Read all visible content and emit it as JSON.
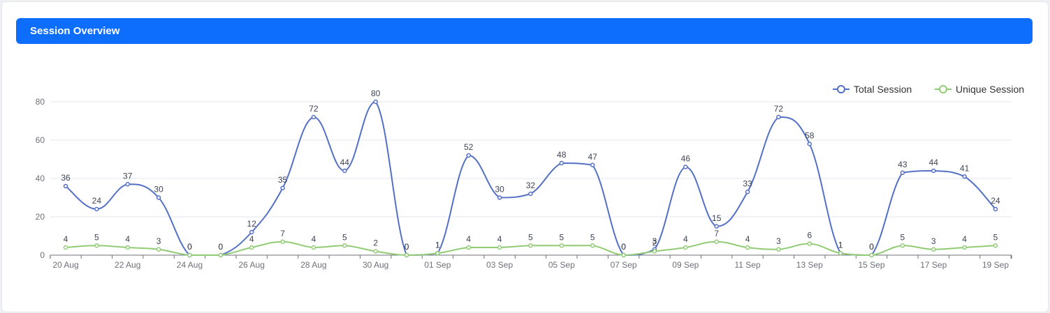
{
  "panel": {
    "title": "Session Overview"
  },
  "colors": {
    "accent": "#0d6efd",
    "total": "#5470c6",
    "unique": "#91cc75"
  },
  "chart_data": {
    "type": "line",
    "smooth": true,
    "categories": [
      "20 Aug",
      "21 Aug",
      "22 Aug",
      "23 Aug",
      "24 Aug",
      "25 Aug",
      "26 Aug",
      "27 Aug",
      "28 Aug",
      "29 Aug",
      "30 Aug",
      "31 Aug",
      "01 Sep",
      "02 Sep",
      "03 Sep",
      "04 Sep",
      "05 Sep",
      "06 Sep",
      "07 Sep",
      "08 Sep",
      "09 Sep",
      "10 Sep",
      "11 Sep",
      "12 Sep",
      "13 Sep",
      "14 Sep",
      "15 Sep",
      "16 Sep",
      "17 Sep",
      "18 Sep",
      "19 Sep"
    ],
    "tick_labels": [
      "20 Aug",
      "22 Aug",
      "24 Aug",
      "26 Aug",
      "28 Aug",
      "30 Aug",
      "01 Sep",
      "03 Sep",
      "05 Sep",
      "07 Sep",
      "09 Sep",
      "11 Sep",
      "13 Sep",
      "15 Sep",
      "17 Sep",
      "19 Sep"
    ],
    "yticks": [
      "0",
      "20",
      "40",
      "60",
      "80"
    ],
    "ylim": [
      0,
      80
    ],
    "grid": true,
    "legend_position": "top-right",
    "series": [
      {
        "name": "Total Session",
        "values": [
          36,
          24,
          37,
          30,
          0,
          0,
          12,
          35,
          72,
          44,
          80,
          0,
          1,
          52,
          30,
          32,
          48,
          47,
          0,
          3,
          46,
          15,
          33,
          72,
          58,
          1,
          0,
          43,
          44,
          41,
          24
        ]
      },
      {
        "name": "Unique Session",
        "values": [
          4,
          5,
          4,
          3,
          0,
          0,
          4,
          7,
          4,
          5,
          2,
          0,
          1,
          4,
          4,
          5,
          5,
          5,
          0,
          2,
          4,
          7,
          4,
          3,
          6,
          1,
          0,
          5,
          3,
          4,
          5
        ]
      }
    ]
  }
}
